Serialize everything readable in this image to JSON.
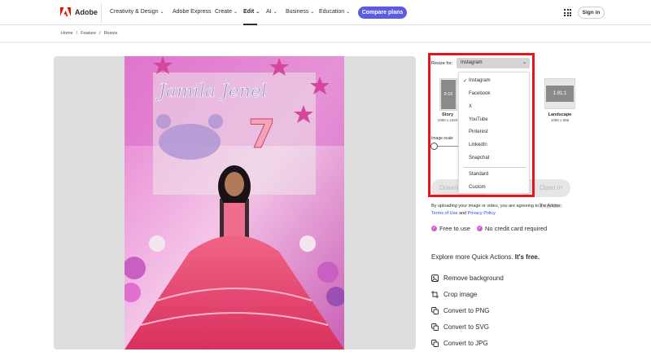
{
  "nav": {
    "brand": "Adobe",
    "items": [
      {
        "label": "Creativity & Design",
        "chevron": true
      },
      {
        "label": "Adobe Express",
        "chevron": false
      },
      {
        "label": "Create",
        "chevron": true
      },
      {
        "label": "Edit",
        "chevron": true,
        "active": true
      },
      {
        "label": "AI",
        "chevron": true
      },
      {
        "label": "Business",
        "chevron": true
      },
      {
        "label": "Education",
        "chevron": true
      }
    ],
    "cta": "Compare plans",
    "signin": "Sign in"
  },
  "breadcrumb": [
    "Home",
    "/",
    "Feature",
    "/",
    "Resize"
  ],
  "panel": {
    "resize_label": "Resize for:",
    "selected": "Instagram",
    "thumbs": [
      {
        "ratio": "9:16",
        "label": "Story",
        "size": "1080 x 1920"
      },
      {
        "ratio": "1.91:1",
        "label": "Landscape",
        "size": "1080 x 566"
      }
    ],
    "scale_label": "Image scale",
    "download": "Download",
    "express": "Open in Express",
    "terms_pre": "By uploading your image or video, you are agreeing to the Adobe",
    "terms_link1": "Terms of Use",
    "terms_and": "and",
    "terms_link2": "Privacy Policy",
    "free": "Free to use",
    "nocard": "No credit card required",
    "explore": "Explore more Quick Actions.",
    "explore_bold": "It's free.",
    "quick_actions": [
      {
        "label": "Remove background",
        "icon": "remove-background-icon"
      },
      {
        "label": "Crop image",
        "icon": "crop-icon"
      },
      {
        "label": "Convert to PNG",
        "icon": "convert-icon"
      },
      {
        "label": "Convert to SVG",
        "icon": "convert-icon"
      },
      {
        "label": "Convert to JPG",
        "icon": "convert-icon"
      }
    ]
  },
  "dropdown": {
    "options": [
      "Instagram",
      "Facebook",
      "X",
      "YouTube",
      "Pinterest",
      "LinkedIn",
      "Snapchat"
    ],
    "extra": [
      "Standard",
      "Custom"
    ],
    "checked": "Instagram"
  },
  "photo": {
    "banner_text": "Jamila Jenel",
    "number": "7"
  },
  "colors": {
    "accent": "#5c5ce0",
    "highlight": "#e3141c",
    "brand": "#eb1000",
    "check": "#d85bd2"
  }
}
